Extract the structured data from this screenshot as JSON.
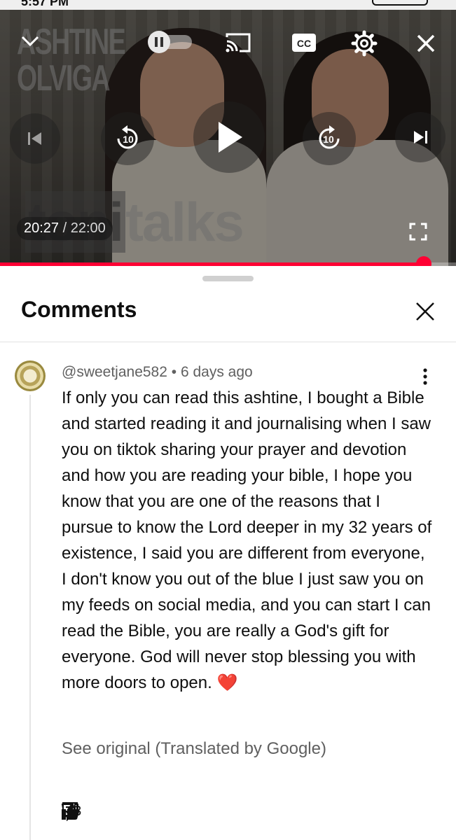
{
  "status_bar": {
    "time": "5:57 PM"
  },
  "video": {
    "overlay_title_line1": "ASHTINE",
    "overlay_title_line2": "OLVIGA",
    "watermark_part1": "toni",
    "watermark_part2": "talks",
    "current_time": "20:27",
    "separator": " / ",
    "duration": "22:00",
    "progress_fraction": 0.93,
    "seek_back_seconds": "10",
    "seek_forward_seconds": "10",
    "cc_label": "CC",
    "accent_color": "#ff0033"
  },
  "comments_panel": {
    "title": "Comments",
    "comment": {
      "author": "@sweetjane582",
      "dot": " • ",
      "age": "6 days ago",
      "text": "If only you can read this ashtine, I bought a Bible and started reading it and journalising when I saw you on tiktok sharing your prayer and devotion and how you are reading your bible, I hope you know that you are one of the reasons that I pursue to know the Lord deeper in my 32 years of existence, I said you are different from everyone, I don't know you out of the blue I just saw you on my feeds on social media, and you can start I can read the Bible, you are really a God's gift for everyone. God will never stop blessing you with more doors to open.",
      "emoji": "❤️",
      "translation_note": "See original (Translated by Google)",
      "likes": "43"
    }
  }
}
